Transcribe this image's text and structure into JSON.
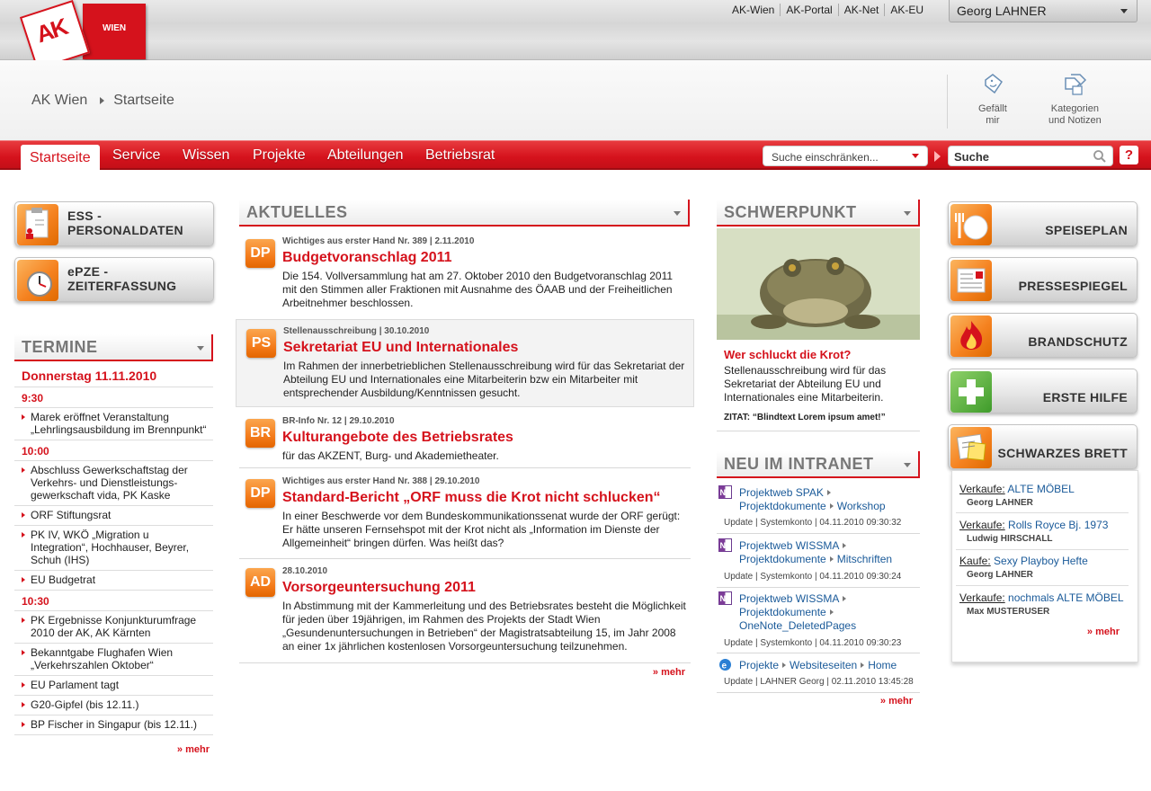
{
  "logo": {
    "text": "AK",
    "sub": "WIEN"
  },
  "toplinks": [
    "AK-Wien",
    "AK-Portal",
    "AK-Net",
    "AK-EU"
  ],
  "user": "Georg LAHNER",
  "breadcrumb": [
    "AK Wien",
    "Startseite"
  ],
  "tools": {
    "like": [
      "Gefällt",
      "mir"
    ],
    "tags": [
      "Kategorien",
      "und Notizen"
    ]
  },
  "nav": {
    "tabs": [
      "Startseite",
      "Service",
      "Wissen",
      "Projekte",
      "Abteilungen",
      "Betriebsrat"
    ],
    "active": "Startseite"
  },
  "search": {
    "scope": "Suche einschränken...",
    "placeholder": "Suche",
    "help": "?"
  },
  "left_tiles": [
    "ESS - PERSONALDATEN",
    "ePZE - ZEITERFASSUNG"
  ],
  "termine": {
    "title": "TERMINE",
    "day": "Donnerstag 11.11.2010",
    "groups": [
      {
        "time": "9:30",
        "items": [
          "Marek eröffnet Veranstaltung „Lehrlingsausbildung im Brennpunkt“"
        ]
      },
      {
        "time": "10:00",
        "items": [
          "Abschluss Gewerkschaftstag der Verkehrs- und Dienstleistungs-gewerkschaft vida, PK Kaske",
          "ORF Stiftungsrat",
          "PK IV, WKÖ „Migration u Integration“, Hochhauser, Beyrer, Schuh (IHS)",
          "EU Budgetrat"
        ]
      },
      {
        "time": "10:30",
        "items": [
          "PK Ergebnisse Konjunkturumfrage 2010 der AK, AK Kärnten",
          "Bekanntgabe Flughafen Wien „Verkehrszahlen Oktober“",
          "EU Parlament tagt",
          "G20-Gipfel (bis 12.11.)",
          "BP Fischer in Singapur (bis 12.11.)"
        ]
      }
    ],
    "more": "» mehr"
  },
  "aktuelles": {
    "title": "AKTUELLES",
    "items": [
      {
        "badge": "DP",
        "meta": "Wichtiges aus erster Hand Nr. 389  |  2.11.2010",
        "title": "Budgetvoranschlag 2011",
        "text": "Die 154. Vollversammlung hat am 27. Oktober 2010 den Budgetvoranschlag 2011 mit den Stimmen aller Fraktionen mit Ausnahme des ÖAAB und der Freiheitlichen Arbeitnehmer beschlossen."
      },
      {
        "badge": "PS",
        "meta": "Stellenausschreibung  |  30.10.2010",
        "title": "Sekretariat EU und Internationales",
        "text": "Im Rahmen der innerbetrieblichen Stellenausschreibung wird für das Sekretariat der Abteilung EU und Internationales  eine Mitarbeiterin bzw ein Mitarbeiter mit entsprechender Ausbildung/Kenntnissen gesucht."
      },
      {
        "badge": "BR",
        "meta": "BR-Info Nr. 12  |  29.10.2010",
        "title": "Kulturangebote des Betriebsrates",
        "text": "für das AKZENT, Burg- und Akademietheater."
      },
      {
        "badge": "DP",
        "meta": "Wichtiges aus erster Hand Nr. 388  |  29.10.2010",
        "title": "Standard-Bericht „ORF muss die Krot nicht schlucken“",
        "text": "In einer Beschwerde vor dem Bundeskommunikationssenat wurde der ORF gerügt: Er hätte unseren Fernsehspot mit der Krot nicht als „Information im Dienste der Allgemeinheit“ bringen dürfen. Was heißt das?"
      },
      {
        "badge": "AD",
        "meta": "28.10.2010",
        "title": "Vorsorgeuntersuchung 2011",
        "text": "In Abstimmung mit der Kammerleitung und des Betriebsrates besteht die Möglichkeit für jeden über 19jährigen, im Rahmen des Projekts der Stadt Wien „Gesundenuntersuchungen in Betrieben“ der Magistratsabteilung 15, im Jahr 2008 an einer 1x jährlichen kostenlosen Vorsorgeuntersuchung teilzunehmen."
      }
    ],
    "more": "» mehr"
  },
  "schwerpunkt": {
    "title": "SCHWERPUNKT",
    "headline": "Wer schluckt die Krot?",
    "text": "Stellenausschreibung wird für das Sekretariat der Abteilung EU und Internationales eine Mitarbeiterin.",
    "zitat": "ZITAT: “Blindtext Lorem ipsum  amet!”"
  },
  "intranet": {
    "title": "NEU IM INTRANET",
    "items": [
      {
        "icon": "onenote-icon",
        "l1": [
          "Projektweb SPAK",
          "Projektdokumente",
          "Workshop"
        ],
        "upd": "Update | Systemkonto | 04.11.2010 09:30:32"
      },
      {
        "icon": "onenote-icon",
        "l1": [
          "Projektweb WISSMA",
          "Projektdokumente",
          "Mitschriften"
        ],
        "upd": "Update | Systemkonto | 04.11.2010 09:30:24"
      },
      {
        "icon": "onenote-icon",
        "l1": [
          "Projektweb WISSMA",
          "Projektdokumente",
          "OneNote_DeletedPages"
        ],
        "upd": "Update | Systemkonto | 04.11.2010 09:30:23"
      },
      {
        "icon": "ie-icon",
        "l1": [
          "Projekte",
          "Websiteseiten",
          "Home"
        ],
        "upd": "Update | LAHNER Georg | 02.11.2010 13:45:28"
      }
    ],
    "more": "» mehr"
  },
  "right_tiles": [
    "SPEISEPLAN",
    "PRESSESPIEGEL",
    "BRANDSCHUTZ",
    "ERSTE HILFE",
    "SCHWARZES BRETT"
  ],
  "brett": {
    "items": [
      {
        "kind": "Verkaufe:",
        "what": "ALTE MÖBEL",
        "who": "Georg LAHNER"
      },
      {
        "kind": "Verkaufe:",
        "what": "Rolls Royce Bj. 1973",
        "who": "Ludwig HIRSCHALL"
      },
      {
        "kind": "Kaufe:",
        "what": "Sexy Playboy Hefte",
        "who": "Georg LAHNER"
      },
      {
        "kind": "Verkaufe:",
        "what": "nochmals ALTE MÖBEL",
        "who": "Max MUSTERUSER"
      }
    ],
    "more": "» mehr"
  },
  "colors": {
    "brand": "#d5121c",
    "tile": "#f58220",
    "link": "#1a5a99"
  }
}
